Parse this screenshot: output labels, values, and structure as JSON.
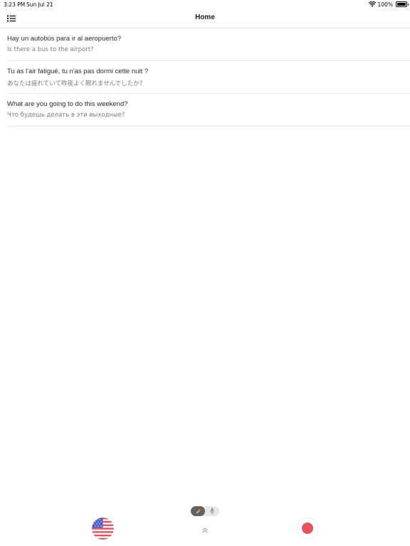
{
  "status_bar": {
    "time": "3:23 PM",
    "date": "Sun Jul 21",
    "battery": "100%",
    "battery_level": 1.0,
    "wifi_icon": "wifi-icon",
    "battery_icon": "battery-icon"
  },
  "nav": {
    "title": "Home",
    "menu_icon": "list-menu-icon"
  },
  "phrases": [
    {
      "source": "Hay un autobús para ir al aeropuerto?",
      "translation": "Is there a bus to the airport?"
    },
    {
      "source": "Tu as l'air fatigué, tu n'as pas dormi cette nuit ?",
      "translation": "あなたは疲れていて昨夜よく眠れませんでしたか?"
    },
    {
      "source": "What are you going to do this weekend?",
      "translation": "Что будешь делать в эти выходные?"
    }
  ],
  "controls": {
    "language_flag_icon": "us-flag-icon",
    "input_modes": [
      {
        "icon": "pencil-icon",
        "selected": true
      },
      {
        "icon": "microphone-icon",
        "selected": false
      }
    ],
    "expand_icon": "chevron-up-double-icon",
    "record_icon": "record-icon",
    "record_color": "#e8505b"
  },
  "colors": {
    "accent_record": "#e8505b",
    "toggle_active": "#5f6368",
    "pencil_yellow": "#f5b400"
  }
}
